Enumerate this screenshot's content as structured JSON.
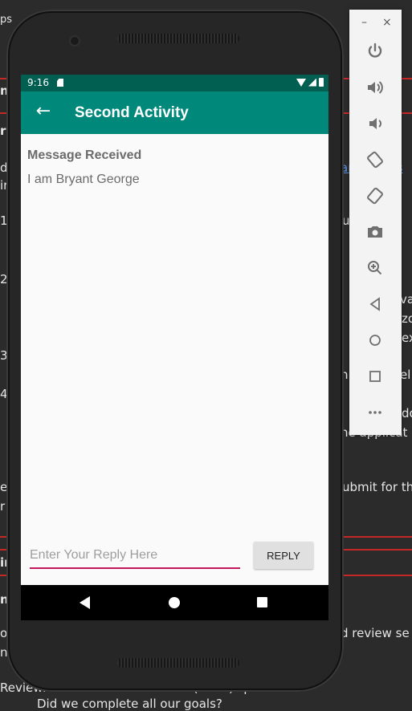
{
  "background": {
    "fragments": [
      {
        "text": "ps"
      },
      {
        "text": "n"
      },
      {
        "text": "re"
      },
      {
        "text": "d"
      },
      {
        "text": "ir"
      },
      {
        "text": "1"
      },
      {
        "text": "2"
      },
      {
        "text": "3"
      },
      {
        "text": "4"
      },
      {
        "text": "e"
      },
      {
        "text": "r"
      },
      {
        "text": "ir"
      },
      {
        "text": "ng"
      },
      {
        "text": "op"
      },
      {
        "text": "n"
      },
      {
        "text": "ar"
      },
      {
        "text": "ts"
      },
      {
        "text": "u"
      },
      {
        "text": "va"
      },
      {
        "text": "zo"
      },
      {
        "text": "ex"
      },
      {
        "text": "n"
      },
      {
        "text": "el"
      },
      {
        "text": "do"
      },
      {
        "text": "he applicat"
      },
      {
        "text": "ubmit for th"
      },
      {
        "text": "d review se"
      },
      {
        "text": "Review: What we did in the last (short) sprint:"
      },
      {
        "text": "Did we complete all our goals?"
      }
    ]
  },
  "emulator": {
    "toolbar": {
      "minimize": "–",
      "close": "×",
      "icons": [
        "power-icon",
        "volume-up-icon",
        "volume-down-icon",
        "rotate-left-icon",
        "rotate-right-icon",
        "camera-icon",
        "zoom-icon",
        "back-icon",
        "home-icon",
        "overview-icon",
        "more-icon"
      ]
    }
  },
  "statusbar": {
    "time": "9:16"
  },
  "appbar": {
    "title": "Second Activity",
    "back_icon": "arrow-left-icon"
  },
  "content": {
    "message_label": "Message Received",
    "message_text": "I am Bryant George"
  },
  "reply": {
    "placeholder": "Enter Your Reply Here",
    "value": "",
    "button_label": "REPLY"
  },
  "colors": {
    "statusbar": "#005f50",
    "appbar": "#00897b",
    "input_underline": "#c2185b"
  }
}
